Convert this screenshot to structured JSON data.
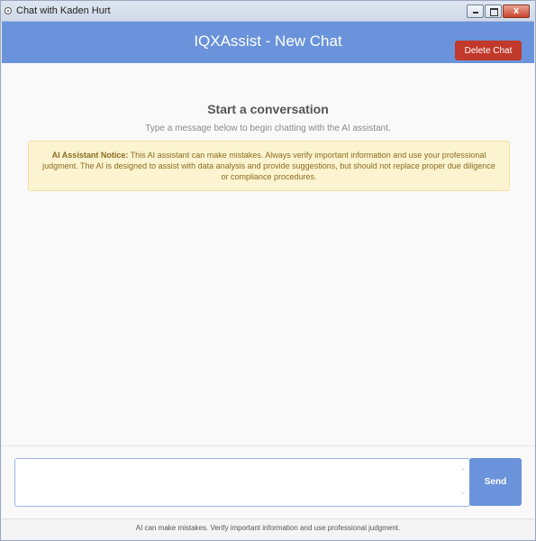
{
  "window": {
    "title": "Chat with Kaden Hurt",
    "close_glyph": "x"
  },
  "header": {
    "title": "IQXAssist - New Chat",
    "delete_label": "Delete Chat",
    "background_color": "#6a93db",
    "delete_color": "#c0392b"
  },
  "chat": {
    "start_title": "Start a conversation",
    "start_subtitle": "Type a message below to begin chatting with the AI assistant.",
    "notice_label": "AI Assistant Notice:",
    "notice_text": " This AI assistant can make mistakes. Always verify important information and use your professional judgment. The AI is designed to assist with data analysis and provide suggestions, but should not replace proper due diligence or compliance procedures."
  },
  "input": {
    "value": "",
    "placeholder": "",
    "send_label": "Send"
  },
  "footer": {
    "text": "AI can make mistakes. Verify important information and use professional judgment."
  },
  "icons": {
    "app": "app-icon",
    "minimize": "minimize-icon",
    "maximize": "maximize-icon",
    "close": "close-icon",
    "scroll_up": "chevron-up-icon",
    "scroll_down": "chevron-down-icon"
  }
}
